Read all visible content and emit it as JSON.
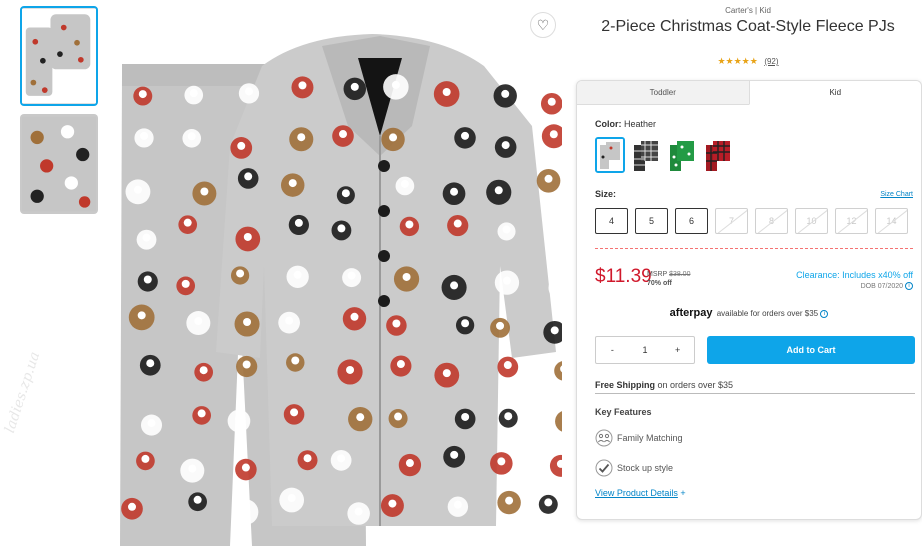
{
  "product": {
    "brand_line": "Carter's | Kid",
    "title": "2-Piece Christmas Coat-Style Fleece PJs",
    "stars": "★★★★★",
    "review_count": "(92)"
  },
  "watermark": "ladies.zp.ua",
  "tabs": [
    {
      "label": "Toddler"
    },
    {
      "label": "Kid"
    }
  ],
  "color": {
    "label": "Color:",
    "selected": "Heather",
    "swatches": [
      "heather",
      "black-plaid",
      "green-print",
      "red-plaid"
    ]
  },
  "size": {
    "label": "Size:",
    "chart_link": "Size Chart",
    "options": [
      {
        "label": "4",
        "available": true
      },
      {
        "label": "5",
        "available": true
      },
      {
        "label": "6",
        "available": true
      },
      {
        "label": "7",
        "available": false
      },
      {
        "label": "8",
        "available": false
      },
      {
        "label": "10",
        "available": false
      },
      {
        "label": "12",
        "available": false
      },
      {
        "label": "14",
        "available": false
      }
    ]
  },
  "pricing": {
    "price": "$11.39",
    "msrp_label": "MSRP",
    "msrp_value": "$38.00",
    "off": "70% off",
    "clearance": "Clearance: Includes x40% off",
    "dob": "DOB 07/2020",
    "info_glyph": "i"
  },
  "afterpay": {
    "logo": "afterpay",
    "text": "available for orders over $35",
    "info_glyph": "i"
  },
  "quantity": {
    "minus": "-",
    "value": "1",
    "plus": "+"
  },
  "add_to_cart": "Add to Cart",
  "shipping": {
    "bold": "Free Shipping",
    "rest": " on orders over $35"
  },
  "key_features": {
    "title": "Key Features",
    "items": [
      {
        "label": "Family Matching",
        "icon": "family-icon"
      },
      {
        "label": "Stock up style",
        "icon": "checkmark-icon"
      }
    ]
  },
  "view_details": {
    "label": "View Product Details",
    "plus": "+"
  },
  "colors": {
    "accent": "#0ea5e9",
    "price_red": "#d0182b",
    "fabric_gray": "#c6c6c6"
  }
}
